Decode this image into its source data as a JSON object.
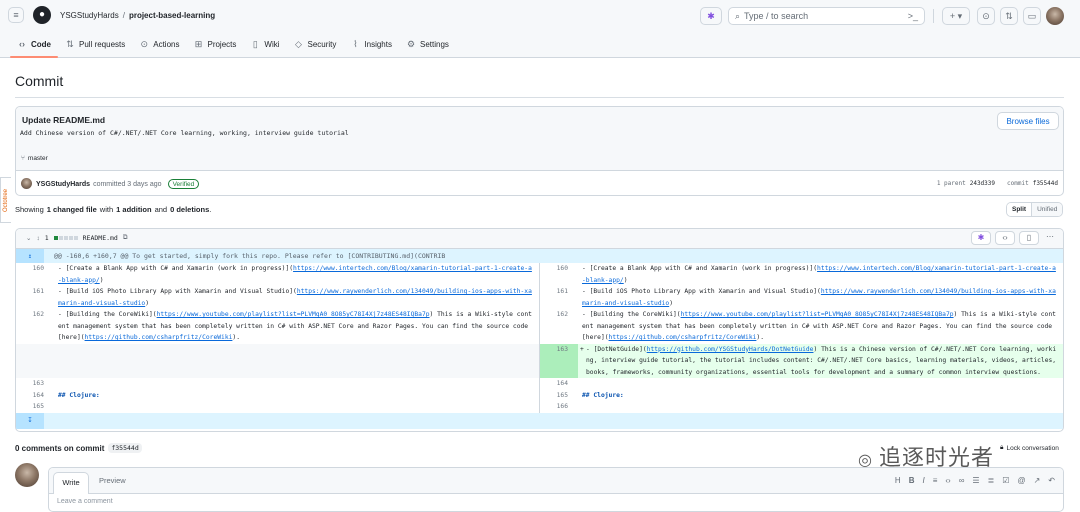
{
  "header": {
    "owner": "YSGStudyHards",
    "separator": "/",
    "repo": "project-based-learning",
    "search_placeholder": "Type / to search",
    "plus_label": "+ ▾"
  },
  "tabs": [
    {
      "label": "Code",
      "icon": "code-icon"
    },
    {
      "label": "Pull requests",
      "icon": "pull-request-icon"
    },
    {
      "label": "Actions",
      "icon": "play-icon"
    },
    {
      "label": "Projects",
      "icon": "table-icon"
    },
    {
      "label": "Wiki",
      "icon": "book-icon"
    },
    {
      "label": "Security",
      "icon": "shield-icon"
    },
    {
      "label": "Insights",
      "icon": "graph-icon"
    },
    {
      "label": "Settings",
      "icon": "gear-icon"
    }
  ],
  "page_title": "Commit",
  "octotree": "Octotree",
  "commit": {
    "title": "Update README.md",
    "description": "Add Chinese version of C#/.NET/.NET Core learning, working, interview guide tutorial",
    "browse_files": "Browse files",
    "branch": "master",
    "author": "YSGStudyHards",
    "committed": "committed 3 days ago",
    "verified": "Verified",
    "parent_label": "1 parent",
    "parent_sha": "243d339",
    "commit_label": "commit",
    "commit_sha": "f35544d"
  },
  "summary": {
    "showing": "Showing",
    "files": "1 changed file",
    "with": "with",
    "additions": "1 addition",
    "and": "and",
    "deletions": "0 deletions",
    "end": ".",
    "split": "Split",
    "unified": "Unified"
  },
  "diff": {
    "count": "1",
    "filename": "README.md",
    "hunk": "@@ -160,6 +160,7 @@ To get started, simply fork this repo. Please refer to [CONTRIBUTING.md](CONTRIB",
    "left": {
      "l160": "160",
      "l161": "161",
      "l162": "162",
      "l163": "163",
      "l164": "164",
      "l165": "165"
    },
    "right": {
      "r160": "160",
      "r161": "161",
      "r162": "162",
      "r163": "163",
      "r164": "164",
      "r165": "165",
      "r166": "166"
    },
    "lines": {
      "c160_pre": "- [Create a Blank App with C# and Xamarin (work in progress)](",
      "c160_link": "https://www.intertech.com/Blog/xamarin-tutorial-part-1-create-a-blank-app/",
      "c160_post": ")",
      "c161_pre": "- [Build iOS Photo Library App with Xamarin and Visual Studio](",
      "c161_link": "https://www.raywenderlich.com/134049/building-ios-apps-with-xamarin-and-visual-studio",
      "c161_post": ")",
      "c162_pre": "- [Building the CoreWiki](",
      "c162_link": "https://www.youtube.com/playlist?list=PLVMqA0_8O85yC78I4Xj7z48ES48IQBa7p",
      "c162_mid": ") This is a Wiki-style content management system that has been completely written in C# with ASP.NET Core and Razor Pages. You can find the source code [here](",
      "c162_link2": "https://github.com/csharpfritz/CoreWiki",
      "c162_post": ").",
      "add_marker": "+",
      "c163_pre": "- [DotNetGuide](",
      "c163_link": "https://github.com/YSGStudyHards/DotNetGuide",
      "c163_post": ") This is a Chinese version of C#/.NET/.NET Core learning, working, interview guide tutorial, the tutorial includes content: C#/.NET/.NET Core basics, learning materials, videos, articles, books, frameworks, community organizations, essential tools for development and a summary of common interview questions.",
      "clojure": "## Clojure:"
    }
  },
  "comments": {
    "heading": "0 comments on commit",
    "sha": "f35544d",
    "lock": "Lock conversation",
    "write": "Write",
    "preview": "Preview",
    "placeholder": "Leave a comment"
  },
  "watermark": "追逐时光者",
  "colors": {
    "accent_tab": "#fd8c73",
    "link": "#0969da",
    "addition_bg": "#e6ffec",
    "addition_ln": "#aceebb",
    "hunk_bg": "#ddf4ff",
    "verified": "#1a7f37"
  }
}
